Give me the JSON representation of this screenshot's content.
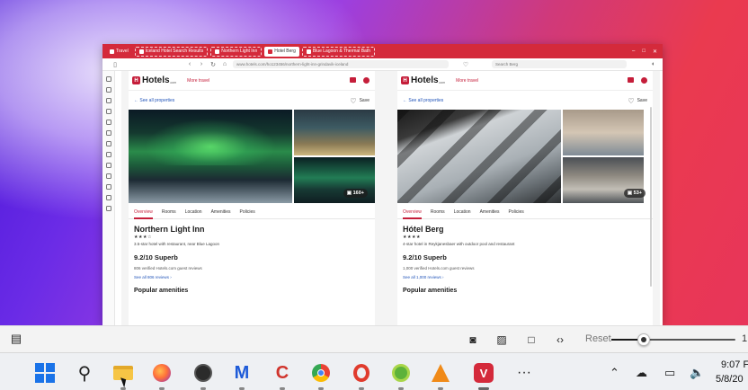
{
  "browser": {
    "tabs": [
      {
        "label": "Travel",
        "style": "plain"
      },
      {
        "label": "Iceland Hotel Search Results",
        "style": "dashed"
      },
      {
        "label": "Northern Light Inn",
        "style": "dashed"
      },
      {
        "label": "Hotel Berg",
        "style": "active"
      },
      {
        "label": "Blue Lagoon & Thermal Bath",
        "style": "dashed"
      }
    ],
    "url": "www.hotels.com/ho123456/northern-light-inn-grindavik-iceland",
    "search_placeholder": "Search Berg",
    "window_controls": [
      "–",
      "□",
      "✕"
    ]
  },
  "hotels_left": {
    "logo": "Hotels",
    "logo_suffix": ".com",
    "more_travel": "More travel",
    "see_all_properties": "See all properties",
    "save": "Save",
    "photo_count": "160+",
    "tabs": [
      "Overview",
      "Rooms",
      "Location",
      "Amenities",
      "Policies"
    ],
    "name": "Northern Light Inn",
    "stars": "★★★☆",
    "description": "3.5-star hotel with restaurant, near Blue Lagoon",
    "rating": "9.2/10 Superb",
    "reviews": "806 verified Hotels.com guest reviews",
    "see_all_reviews": "See all 806 reviews",
    "popular_amenities": "Popular amenities"
  },
  "hotels_right": {
    "logo": "Hotels",
    "logo_suffix": ".com",
    "more_travel": "More travel",
    "see_all_properties": "See all properties",
    "save": "Save",
    "photo_count": "53+",
    "tabs": [
      "Overview",
      "Rooms",
      "Location",
      "Amenities",
      "Policies"
    ],
    "name": "Hótel Berg",
    "stars": "★★★★",
    "description": "4-star hotel in Reykjanesbaer with outdoor pool and restaurant",
    "rating": "9.2/10 Superb",
    "reviews": "1,000 verified Hotels.com guest reviews",
    "see_all_reviews": "See all 1,000 reviews",
    "popular_amenities": "Popular amenities"
  },
  "snip_toolbar": {
    "reset_label": "Reset",
    "edge_label": "1",
    "zoom_level": 0.26
  },
  "taskbar": {
    "time": "9:07 F",
    "date": "5/8/20",
    "apps": [
      "start",
      "search",
      "file-explorer",
      "firefox",
      "obs",
      "malwarebytes",
      "ccleaner",
      "chrome",
      "opera",
      "app-green",
      "vlc",
      "vivaldi",
      "more"
    ]
  },
  "colors": {
    "brand": "#c51e3a",
    "browser_chrome": "#d42a3b",
    "link": "#2154b9"
  }
}
